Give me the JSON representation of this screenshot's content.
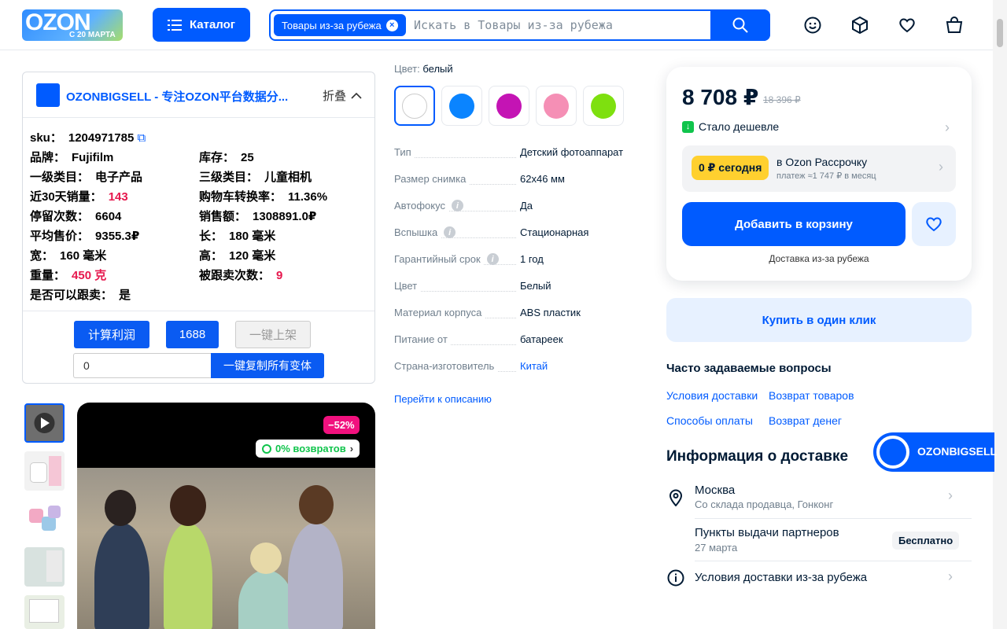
{
  "header": {
    "logo": "OZON",
    "logo_sub": "С 20 МАРТА",
    "catalog": "Каталог",
    "search_chip": "Товары из-за рубежа",
    "search_placeholder": "Искать в Товары из-за рубежа"
  },
  "plugin": {
    "title": "OZONBIGSELL - 专注OZON平台数据分...",
    "fold": "折叠",
    "fields": {
      "sku_k": "sku：",
      "sku_v": "1204971785",
      "brand_k": "品牌：",
      "brand_v": "Fujifilm",
      "stock_k": "库存：",
      "stock_v": "25",
      "cat1_k": "一级类目：",
      "cat1_v": "电子产品",
      "cat3_k": "三级类目：",
      "cat3_v": "儿童相机",
      "sales30_k": "近30天销量：",
      "sales30_v": "143",
      "conv_k": "购物车转换率：",
      "conv_v": "11.36%",
      "stay_k": "停留次数：",
      "stay_v": "6604",
      "amount_k": "销售额：",
      "amount_v": "1308891.0₽",
      "avg_k": "平均售价：",
      "avg_v": "9355.3₽",
      "len_k": "长：",
      "len_v": "180 毫米",
      "wid_k": "宽：",
      "wid_v": "160 毫米",
      "hei_k": "高：",
      "hei_v": "120 毫米",
      "weight_k": "重量：",
      "weight_v": "450 克",
      "follow_k": "被跟卖次数：",
      "follow_v": "9",
      "canfollow_k": "是否可以跟卖：",
      "canfollow_v": "是"
    },
    "btn_profit": "计算利润",
    "btn_1688": "1688",
    "btn_list": "一键上架",
    "input_value": "0",
    "btn_copy": "一键复制所有变体"
  },
  "gallery": {
    "discount": "−52%",
    "returns": "0% возвратов"
  },
  "specs": {
    "color_label": "Цвет:",
    "color_value": "белый",
    "swatches": [
      "#ffffff",
      "#0a84ff",
      "#c414b4",
      "#f58fb5",
      "#7ee00f"
    ],
    "rows": [
      {
        "k": "Тип",
        "v": "Детский фотоаппарат"
      },
      {
        "k": "Размер снимка",
        "v": "62x46 мм"
      },
      {
        "k": "Автофокус",
        "v": "Да"
      },
      {
        "k": "Вспышка",
        "v": "Стационарная"
      },
      {
        "k": "Гарантийный срок",
        "v": "1 год"
      },
      {
        "k": "Цвет",
        "v": "Белый"
      },
      {
        "k": "Материал корпуса",
        "v": "ABS пластик"
      },
      {
        "k": "Питание от",
        "v": "батареек"
      },
      {
        "k": "Страна-изготовитель",
        "v": "Китай"
      }
    ],
    "goto": "Перейти к описанию"
  },
  "buy": {
    "price": "8 708 ₽",
    "old_price": "18 396 ₽",
    "cheaper": "Стало дешевле",
    "installment_today": "0 ₽ сегодня",
    "installment_title": "в Ozon Рассрочку",
    "installment_sub": "платеж ≈1 747 ₽ в месяц",
    "add_to_cart": "Добавить в корзину",
    "delivery_note": "Доставка из-за рубежа",
    "one_click": "Купить в один клик"
  },
  "faq": {
    "title": "Часто задаваемые вопросы",
    "links": [
      "Условия доставки",
      "Возврат товаров",
      "Способы оплаты",
      "Возврат денег"
    ]
  },
  "delivery": {
    "title": "Информация о доставке",
    "city": "Москва",
    "city_sub": "Со склада продавца, Гонконг",
    "pickup": "Пункты выдачи партнеров",
    "pickup_date": "27 марта",
    "pickup_price": "Бесплатно",
    "abroad": "Условия доставки из-за рубежа"
  },
  "floating": {
    "label": "OZONBIGSELL"
  }
}
